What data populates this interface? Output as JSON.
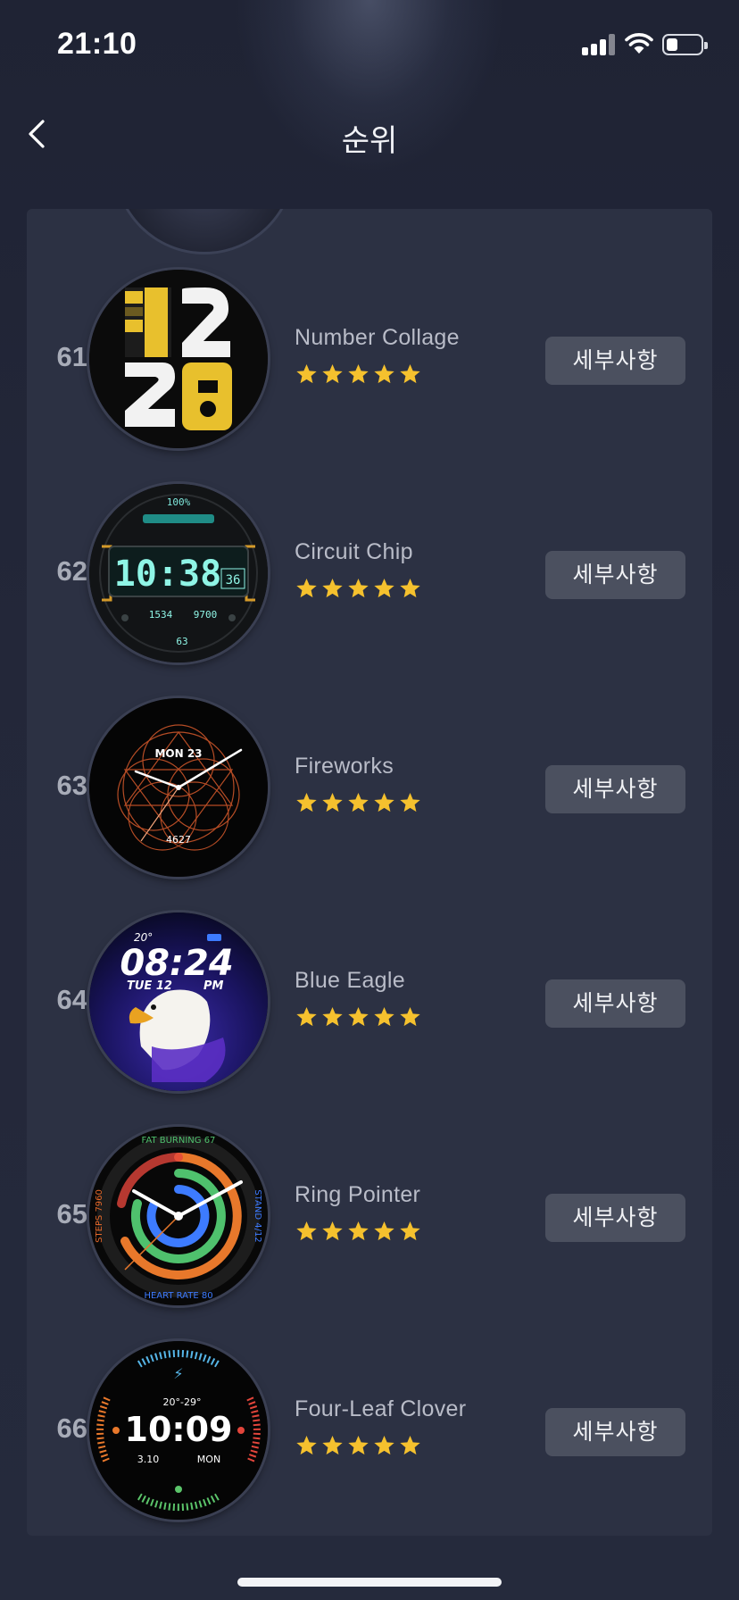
{
  "status_bar": {
    "time": "21:10"
  },
  "nav": {
    "title": "순위"
  },
  "items": [
    {
      "rank": "61",
      "name": "Number Collage",
      "rating": 5,
      "button": "세부사항",
      "face": "collage"
    },
    {
      "rank": "62",
      "name": "Circuit Chip",
      "rating": 5,
      "button": "세부사항",
      "face": "circuit"
    },
    {
      "rank": "63",
      "name": "Fireworks",
      "rating": 5,
      "button": "세부사항",
      "face": "fireworks"
    },
    {
      "rank": "64",
      "name": "Blue Eagle",
      "rating": 5,
      "button": "세부사항",
      "face": "eagle"
    },
    {
      "rank": "65",
      "name": "Ring Pointer",
      "rating": 5,
      "button": "세부사항",
      "face": "rings"
    },
    {
      "rank": "66",
      "name": "Four-Leaf Clover",
      "rating": 5,
      "button": "세부사항",
      "face": "clover"
    }
  ],
  "faces": {
    "circuit": {
      "battery": "100%",
      "time": "10:38",
      "seconds": "36",
      "steps": "1534",
      "distance": "9700",
      "heart": "63"
    },
    "fireworks": {
      "date": "MON 23",
      "steps": "4627"
    },
    "eagle": {
      "temp": "20°",
      "time": "08:24",
      "date": "TUE 12",
      "ampm": "PM"
    },
    "rings": {
      "top": "FAT BURNING 67",
      "right": "STAND 4/12",
      "left": "STEPS 7960",
      "bottom": "HEART RATE 80"
    },
    "clover": {
      "weather": "20°-29°",
      "time": "10:09",
      "date": "3.10",
      "day": "MON"
    }
  },
  "colors": {
    "star": "#f5c12e",
    "button_bg": "#4b505f",
    "panel_bg": "#2c3143"
  }
}
